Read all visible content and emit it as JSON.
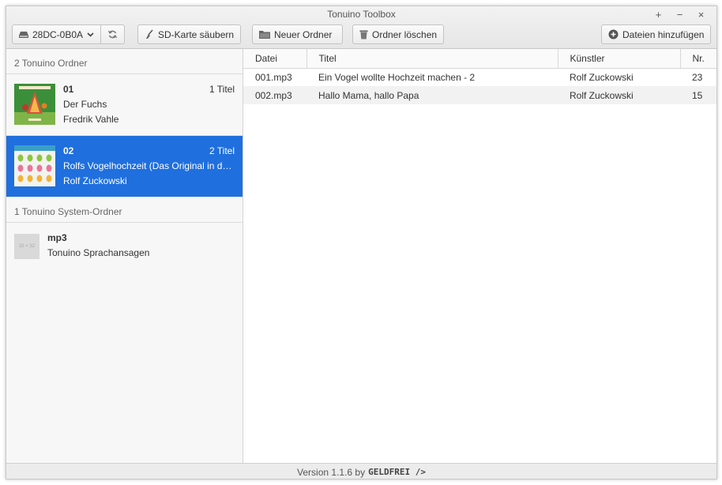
{
  "window": {
    "title": "Tonuino Toolbox",
    "controls": {
      "new": "+",
      "minimize": "−",
      "close": "×"
    }
  },
  "toolbar": {
    "device_label": "28DC-0B0A",
    "clean_label": "SD-Karte säubern",
    "new_folder_label": "Neuer Ordner",
    "delete_folder_label": "Ordner löschen",
    "add_files_label": "Dateien hinzufügen"
  },
  "sidebar": {
    "folders_header": "2 Tonuino Ordner",
    "folders": [
      {
        "name": "01",
        "count": "1 Titel",
        "album": "Der Fuchs",
        "artist": "Fredrik Vahle",
        "selected": false
      },
      {
        "name": "02",
        "count": "2 Titel",
        "album": "Rolfs Vogelhochzeit (Das Original in der Originalfassung)",
        "artist": "Rolf Zuckowski",
        "selected": true
      }
    ],
    "system_header": "1 Tonuino System-Ordner",
    "system_folders": [
      {
        "name": "mp3",
        "description": "Tonuino Sprachansagen",
        "thumb_text": "32 × 32"
      }
    ]
  },
  "table": {
    "columns": [
      "Datei",
      "Titel",
      "Künstler",
      "Nr."
    ],
    "rows": [
      [
        "001.mp3",
        "Ein Vogel wollte Hochzeit machen - 2",
        "Rolf Zuckowski",
        "23"
      ],
      [
        "002.mp3",
        "Hallo Mama, hallo Papa",
        "Rolf Zuckowski",
        "15"
      ]
    ]
  },
  "footer": {
    "version_text": "Version 1.1.6 by",
    "brand": "GELDFREI />"
  },
  "colors": {
    "selection": "#1f6fde",
    "alt_row": "#f2f2f2"
  }
}
